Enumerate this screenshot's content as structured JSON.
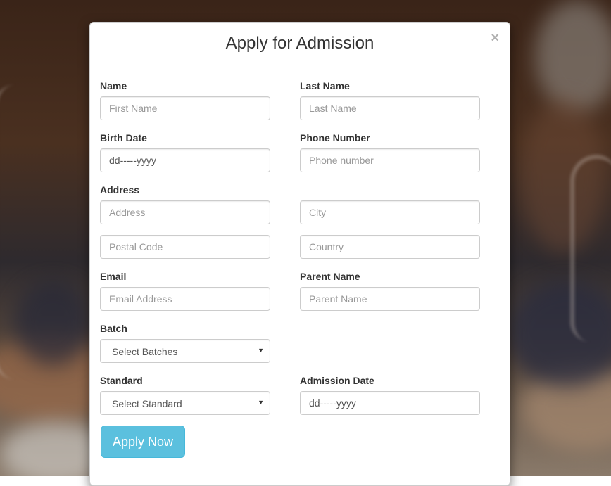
{
  "modal": {
    "title": "Apply for Admission",
    "close_label": "×"
  },
  "form": {
    "name_label": "Name",
    "first_name_placeholder": "First Name",
    "last_name_label": "Last Name",
    "last_name_placeholder": "Last Name",
    "birth_date_label": "Birth Date",
    "birth_date_value": "dd-----yyyy",
    "phone_label": "Phone Number",
    "phone_placeholder": "Phone number",
    "address_label": "Address",
    "address_placeholder": "Address",
    "city_placeholder": "City",
    "postal_code_placeholder": "Postal Code",
    "country_placeholder": "Country",
    "email_label": "Email",
    "email_placeholder": "Email Address",
    "parent_name_label": "Parent Name",
    "parent_name_placeholder": "Parent Name",
    "batch_label": "Batch",
    "batch_selected": "Select Batches",
    "standard_label": "Standard",
    "standard_selected": "Select Standard",
    "admission_date_label": "Admission Date",
    "admission_date_value": "dd-----yyyy",
    "submit_label": "Apply Now"
  },
  "icons": {
    "dropdown_arrow": "▼"
  },
  "colors": {
    "button_bg": "#5bc0de",
    "button_text": "#ffffff"
  }
}
